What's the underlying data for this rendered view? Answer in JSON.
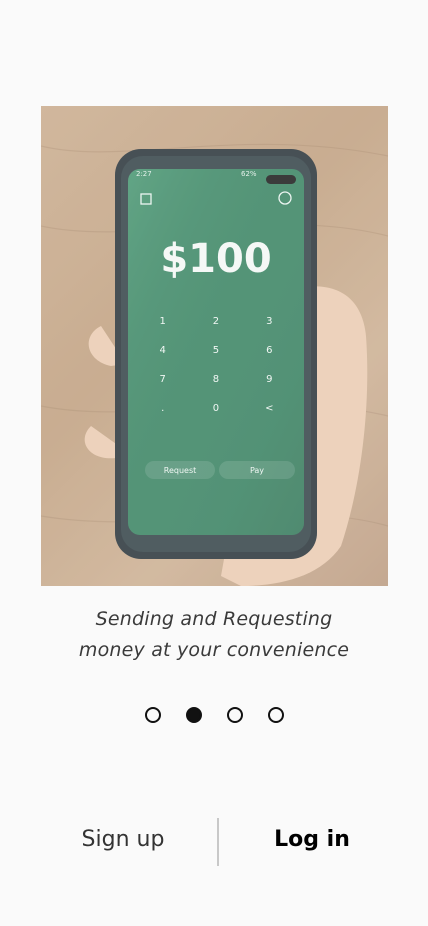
{
  "hero": {
    "amount": "$100",
    "keypad": [
      "1",
      "2",
      "3",
      "4",
      "5",
      "6",
      "7",
      "8",
      "9",
      ".",
      "0",
      "<"
    ],
    "request_label": "Request",
    "pay_label": "Pay",
    "status_time": "2:27",
    "status_battery": "62%"
  },
  "caption": {
    "line1": "Sending and Requesting",
    "line2": "money at your convenience"
  },
  "pager": {
    "count": 4,
    "active_index": 1
  },
  "actions": {
    "signup_label": "Sign up",
    "login_label": "Log in"
  },
  "colors": {
    "background": "#fafafa",
    "phone_screen": "#2f7d5a",
    "dot": "#111111"
  }
}
